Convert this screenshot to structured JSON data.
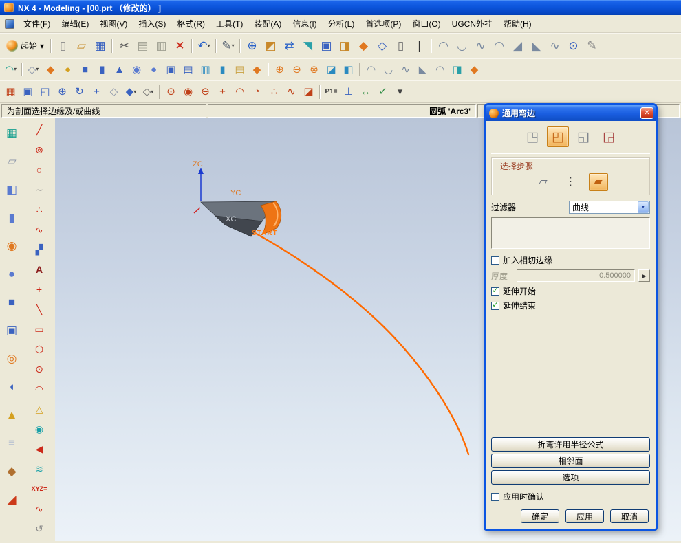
{
  "colors": {
    "accent_orange": "#ff6a00",
    "titlebar_blue": "#0b55e2",
    "selected_tile": "#f2b45a",
    "flange_orange": "#ee7414"
  },
  "window": {
    "title": "NX 4 - Modeling - [00.prt （修改的） ]"
  },
  "menu": {
    "items": [
      {
        "name": "menu-file",
        "label": "文件(F)"
      },
      {
        "name": "menu-edit",
        "label": "编辑(E)"
      },
      {
        "name": "menu-view",
        "label": "视图(V)"
      },
      {
        "name": "menu-insert",
        "label": "插入(S)"
      },
      {
        "name": "menu-format",
        "label": "格式(R)"
      },
      {
        "name": "menu-tools",
        "label": "工具(T)"
      },
      {
        "name": "menu-assemblies",
        "label": "装配(A)"
      },
      {
        "name": "menu-information",
        "label": "信息(I)"
      },
      {
        "name": "menu-analysis",
        "label": "分析(L)"
      },
      {
        "name": "menu-preferences",
        "label": "首选项(P)"
      },
      {
        "name": "menu-window",
        "label": "窗口(O)"
      },
      {
        "name": "menu-ugcn",
        "label": "UGCN外挂"
      },
      {
        "name": "menu-help",
        "label": "帮助(H)"
      }
    ]
  },
  "toolbars": {
    "start": {
      "label": "起始",
      "caret": "▾"
    },
    "row1": [
      {
        "name": "new-icon",
        "glyph": "▯",
        "color": "#8a8a8a"
      },
      {
        "name": "open-icon",
        "glyph": "▱",
        "color": "#c89030"
      },
      {
        "name": "save-icon",
        "glyph": "▦",
        "color": "#3a62c0"
      },
      {
        "sep": true
      },
      {
        "name": "cut-icon",
        "glyph": "✂",
        "color": "#555555"
      },
      {
        "name": "copy-icon",
        "glyph": "▤",
        "color": "#a0a092"
      },
      {
        "name": "paste-icon",
        "glyph": "▥",
        "color": "#a0a092"
      },
      {
        "name": "delete-icon",
        "glyph": "✕",
        "color": "#cc2a1a"
      },
      {
        "sep": true
      },
      {
        "name": "undo-icon",
        "glyph": "↶",
        "color": "#2a62c8",
        "caret": "▾"
      },
      {
        "sep": true
      },
      {
        "name": "journal-icon",
        "glyph": "✎",
        "color": "#556070",
        "caret": "▾"
      },
      {
        "sep": true
      },
      {
        "name": "web-browser-icon",
        "glyph": "⊕",
        "color": "#2a62c8"
      },
      {
        "name": "visual-report-icon",
        "glyph": "◩",
        "color": "#c8882a"
      },
      {
        "name": "shortcut-keys-icon",
        "glyph": "⇄",
        "color": "#2a62c8"
      },
      {
        "name": "sail-icon",
        "glyph": "◥",
        "color": "#2aa0a8"
      },
      {
        "name": "window-layout-icon",
        "glyph": "▣",
        "color": "#3a62c0"
      },
      {
        "name": "display-part-icon",
        "glyph": "◨",
        "color": "#c8882a"
      },
      {
        "name": "work-part-icon",
        "glyph": "◆",
        "color": "#e07820"
      },
      {
        "name": "component-icon",
        "glyph": "◇",
        "color": "#3a62c0"
      },
      {
        "name": "info-window-icon",
        "glyph": "▯",
        "color": "#707070"
      },
      {
        "name": "cursor-select-icon",
        "glyph": "|",
        "color": "#333333"
      },
      {
        "sep": true
      },
      {
        "name": "swept-surface-icon",
        "glyph": "◠",
        "color": "#7a8aa0"
      },
      {
        "name": "ruled-surface-icon",
        "glyph": "◡",
        "color": "#7a8aa0"
      },
      {
        "name": "curve-mesh-icon",
        "glyph": "∿",
        "color": "#7a8aa0"
      },
      {
        "name": "bridge-surface-icon",
        "glyph": "◠",
        "color": "#7a8aa0"
      },
      {
        "name": "corner-surface-icon",
        "glyph": "◢",
        "color": "#7a8aa0"
      },
      {
        "name": "extend-surface-icon",
        "glyph": "◣",
        "color": "#7a8aa0"
      },
      {
        "name": "law-extension-icon",
        "glyph": "∿",
        "color": "#7a8aa0"
      },
      {
        "name": "zoom-check-icon",
        "glyph": "⊙",
        "color": "#3a62c0"
      },
      {
        "name": "annotate-icon",
        "glyph": "✎",
        "color": "#8a8a8a"
      }
    ],
    "row2": [
      {
        "name": "sketch-icon",
        "glyph": "◠",
        "color": "#18a090",
        "caret": "▾"
      },
      {
        "sep": true
      },
      {
        "name": "datum-plane-icon",
        "glyph": "◇",
        "color": "#8a94a8",
        "caret": "▾"
      },
      {
        "name": "extrude-icon",
        "glyph": "◆",
        "color": "#e07820"
      },
      {
        "name": "revolve-icon",
        "glyph": "●",
        "color": "#d4a020"
      },
      {
        "name": "block-icon",
        "glyph": "■",
        "color": "#3a62c0"
      },
      {
        "name": "cylinder-icon",
        "glyph": "▮",
        "color": "#3a62c0"
      },
      {
        "name": "cone-icon",
        "glyph": "▲",
        "color": "#3a62c0"
      },
      {
        "name": "hole-icon",
        "glyph": "◉",
        "color": "#5a7ad0"
      },
      {
        "name": "boss-icon",
        "glyph": "●",
        "color": "#5a7ad0"
      },
      {
        "name": "pocket-icon",
        "glyph": "▣",
        "color": "#3a62c0"
      },
      {
        "name": "pad-icon",
        "glyph": "▤",
        "color": "#3a62c0"
      },
      {
        "name": "emboss-icon",
        "glyph": "▥",
        "color": "#2a8ac0"
      },
      {
        "name": "rib-icon",
        "glyph": "▮",
        "color": "#2a8ac0"
      },
      {
        "name": "catalog-icon",
        "glyph": "▤",
        "color": "#c8a040"
      },
      {
        "name": "user-feature-icon",
        "glyph": "◆",
        "color": "#e07820"
      },
      {
        "sep": true
      },
      {
        "name": "unite-icon",
        "glyph": "⊕",
        "color": "#e07820"
      },
      {
        "name": "subtract-icon",
        "glyph": "⊖",
        "color": "#e07820"
      },
      {
        "name": "intersect-icon",
        "glyph": "⊗",
        "color": "#e07820"
      },
      {
        "name": "trim-body-icon",
        "glyph": "◪",
        "color": "#2a8ac0"
      },
      {
        "name": "thicken-icon",
        "glyph": "◧",
        "color": "#2a8ac0"
      },
      {
        "sep": true
      },
      {
        "name": "through-curves-icon",
        "glyph": "◠",
        "color": "#7a8aa0"
      },
      {
        "name": "swept-icon",
        "glyph": "◡",
        "color": "#7a8aa0"
      },
      {
        "name": "section-surface-icon",
        "glyph": "∿",
        "color": "#7a8aa0"
      },
      {
        "name": "n-sided-surface-icon",
        "glyph": "◣",
        "color": "#7a8aa0"
      },
      {
        "name": "studio-surface-icon",
        "glyph": "◠",
        "color": "#7a8aa0"
      },
      {
        "name": "offset-surface-icon",
        "glyph": "◨",
        "color": "#2aa0a8"
      },
      {
        "name": "sheet-metal-flange-icon",
        "glyph": "◆",
        "color": "#e07820"
      }
    ],
    "row3": [
      {
        "name": "snap-grid-icon",
        "glyph": "▦",
        "color": "#c04018"
      },
      {
        "name": "fit-view-icon",
        "glyph": "▣",
        "color": "#3a62c0"
      },
      {
        "name": "zoom-box-icon",
        "glyph": "◱",
        "color": "#3a62c0"
      },
      {
        "name": "zoom-icon",
        "glyph": "⊕",
        "color": "#3a62c0"
      },
      {
        "name": "rotate-view-icon",
        "glyph": "↻",
        "color": "#3a62c0"
      },
      {
        "name": "pan-view-icon",
        "glyph": "+",
        "color": "#3a62c0"
      },
      {
        "name": "perspective-icon",
        "glyph": "◇",
        "color": "#8a94a8"
      },
      {
        "name": "shaded-view-icon",
        "glyph": "◆",
        "color": "#3a62c0",
        "caret": "▾"
      },
      {
        "name": "wireframe-view-icon",
        "glyph": "◇",
        "color": "#707070",
        "caret": "▾"
      },
      {
        "sep": true
      },
      {
        "name": "snap-point-icon",
        "glyph": "⊙",
        "color": "#c04018"
      },
      {
        "name": "endpoint-snap-icon",
        "glyph": "◉",
        "color": "#c04018"
      },
      {
        "name": "midpoint-snap-icon",
        "glyph": "⊖",
        "color": "#c04018"
      },
      {
        "name": "intersection-snap-icon",
        "glyph": "+",
        "color": "#c04018"
      },
      {
        "name": "arc-center-snap-icon",
        "glyph": "◠",
        "color": "#c04018"
      },
      {
        "name": "quadrant-snap-icon",
        "glyph": "◔",
        "color": "#c04018"
      },
      {
        "name": "existing-point-snap-icon",
        "glyph": "∴",
        "color": "#c04018"
      },
      {
        "name": "point-on-curve-snap-icon",
        "glyph": "∿",
        "color": "#c04018"
      },
      {
        "name": "point-on-face-snap-icon",
        "glyph": "◪",
        "color": "#c04018"
      },
      {
        "sep": true
      },
      {
        "name": "p1-expression-icon",
        "glyph": "P1=",
        "color": "#333333"
      },
      {
        "name": "constraint-icon",
        "glyph": "⊥",
        "color": "#3a62c0"
      },
      {
        "name": "auto-dimension-icon",
        "glyph": "↔",
        "color": "#2a8a40"
      },
      {
        "name": "finish-flag-icon",
        "glyph": "✓",
        "color": "#2a8a40"
      },
      {
        "name": "more-options-caret",
        "glyph": "▾",
        "color": "#444444"
      }
    ]
  },
  "prompt": {
    "status": "为剖面选择边缘及/或曲线",
    "selection": "圆弧 'Arc3'"
  },
  "left_toolbar": {
    "col1": [
      {
        "name": "sketch-task-icon",
        "glyph": "▦",
        "color": "#18a090"
      },
      {
        "name": "datum-csys-icon",
        "glyph": "▱",
        "color": "#8a94a8"
      },
      {
        "name": "extrude-feature-icon",
        "glyph": "◧",
        "color": "#5a7ad0"
      },
      {
        "name": "cylinder-feature-icon",
        "glyph": "▮",
        "color": "#5a7ad0"
      },
      {
        "name": "hole-feature-icon",
        "glyph": "◉",
        "color": "#e07820"
      },
      {
        "name": "boss-feature-icon",
        "glyph": "●",
        "color": "#5a7ad0"
      },
      {
        "name": "block-feature-icon",
        "glyph": "■",
        "color": "#3a62c0"
      },
      {
        "name": "blend-feature-icon",
        "glyph": "▣",
        "color": "#3a62c0"
      },
      {
        "name": "torus-feature-icon",
        "glyph": "◎",
        "color": "#e07820"
      },
      {
        "name": "shell-feature-icon",
        "glyph": "◖",
        "color": "#3a62c0"
      },
      {
        "name": "cone-feature-icon",
        "glyph": "▲",
        "color": "#d4a020"
      },
      {
        "name": "stack-feature-icon",
        "glyph": "≡",
        "color": "#3a62c0"
      },
      {
        "name": "sweep-feature-icon",
        "glyph": "◆",
        "color": "#b07030"
      },
      {
        "name": "draft-feature-icon",
        "glyph": "◢",
        "color": "#cc3a1a"
      }
    ],
    "col2": [
      {
        "name": "line-icon",
        "glyph": "╱",
        "color": "#cc2a1a"
      },
      {
        "name": "circle-center-icon",
        "glyph": "⊚",
        "color": "#cc2a1a"
      },
      {
        "name": "circle-icon",
        "glyph": "○",
        "color": "#cc2a1a"
      },
      {
        "name": "derived-line-icon",
        "glyph": "∼",
        "color": "#888888"
      },
      {
        "name": "points-set-icon",
        "glyph": "∴",
        "color": "#cc2a1a"
      },
      {
        "name": "spline-icon",
        "glyph": "∿",
        "color": "#cc2a1a"
      },
      {
        "name": "point-pattern-icon",
        "glyph": "▞",
        "color": "#3a62c0"
      },
      {
        "name": "text-curve-icon",
        "glyph": "A",
        "color": "#8a1a1a"
      },
      {
        "name": "point-icon",
        "glyph": "+",
        "color": "#cc2a1a"
      },
      {
        "name": "angled-line-icon",
        "glyph": "╲",
        "color": "#cc2a1a"
      },
      {
        "name": "rectangle-icon",
        "glyph": "▭",
        "color": "#cc2a1a"
      },
      {
        "name": "polygon-icon",
        "glyph": "⬡",
        "color": "#cc2a1a"
      },
      {
        "name": "ellipse-icon",
        "glyph": "⊙",
        "color": "#cc2a1a"
      },
      {
        "name": "conic-icon",
        "glyph": "◠",
        "color": "#cc2a1a"
      },
      {
        "name": "helix-icon",
        "glyph": "△",
        "color": "#d4a020"
      },
      {
        "name": "droplet-icon",
        "glyph": "◉",
        "color": "#18a0a8"
      },
      {
        "name": "direction-arrow-icon",
        "glyph": "◀",
        "color": "#cc2a1a"
      },
      {
        "name": "law-curve-icon",
        "glyph": "≋",
        "color": "#18a0a8"
      },
      {
        "name": "xyz-expression-icon",
        "glyph": "XYZ=",
        "color": "#cc2a1a"
      },
      {
        "name": "wave-curve-icon",
        "glyph": "∿",
        "color": "#cc2a1a"
      },
      {
        "name": "spiral-icon",
        "glyph": "↺",
        "color": "#888888"
      }
    ]
  },
  "viewport": {
    "labels": {
      "zc": "ZC",
      "yc": "YC",
      "xc": "XC",
      "start": "START"
    }
  },
  "dialog": {
    "title": "通用弯边",
    "close_glyph": "✕",
    "flange_types": [
      {
        "name": "bend-icon",
        "glyph": "◳",
        "color": "#606878"
      },
      {
        "name": "general-flange-icon",
        "glyph": "◰",
        "color": "#c06010",
        "selected": true
      },
      {
        "name": "flange-icon",
        "glyph": "◱",
        "color": "#606878"
      },
      {
        "name": "inset-bend-icon",
        "glyph": "◲",
        "color": "#a03030"
      }
    ],
    "steps": {
      "label": "选择步骤",
      "icons": [
        {
          "name": "step-base-edge-icon",
          "glyph": "▱",
          "color": "#606878"
        },
        {
          "name": "step-sequence-icon",
          "glyph": "⋮",
          "color": "#404040"
        },
        {
          "name": "step-section-icon",
          "glyph": "▰",
          "color": "#c06010",
          "selected": true
        }
      ]
    },
    "filter": {
      "label": "过滤器",
      "value": "曲线",
      "arrow_glyph": "▼"
    },
    "tangent": {
      "label": "加入相切边缘",
      "checked": false
    },
    "thickness": {
      "label": "厚度",
      "value": "0.500000",
      "flip_glyph": "▶"
    },
    "extend_start": {
      "label": "延伸开始",
      "checked": true
    },
    "extend_end": {
      "label": "延伸结束",
      "checked": true
    },
    "action_buttons": [
      {
        "name": "bend-formula-button",
        "label": "折弯许用半径公式"
      },
      {
        "name": "adjacent-faces-button",
        "label": "相邻面"
      },
      {
        "name": "options-button",
        "label": "选项"
      }
    ],
    "confirm": {
      "label": "应用时确认",
      "checked": false
    },
    "footer_buttons": [
      {
        "name": "ok-button",
        "label": "确定"
      },
      {
        "name": "apply-button",
        "label": "应用"
      },
      {
        "name": "cancel-button",
        "label": "取消"
      }
    ]
  }
}
